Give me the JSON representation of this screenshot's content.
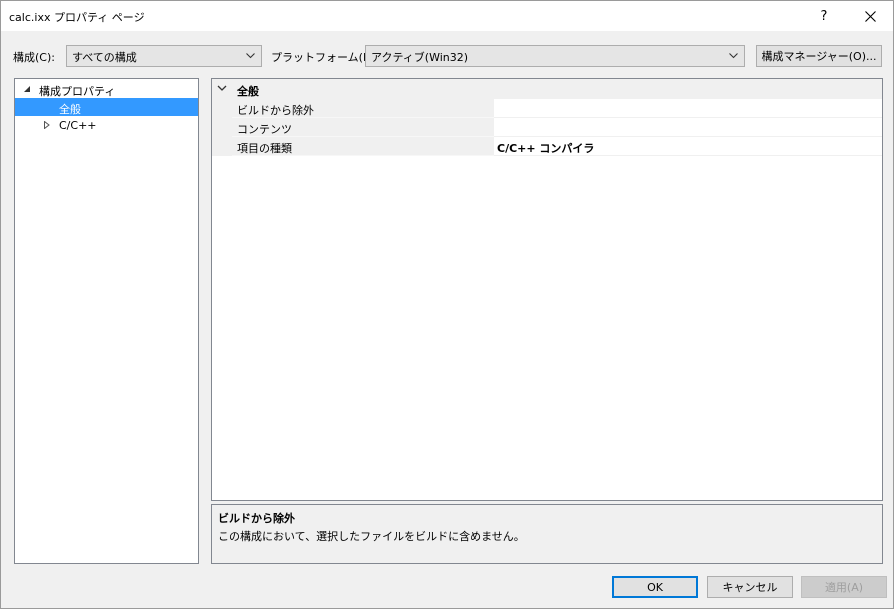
{
  "window": {
    "title": "calc.ixx プロパティ ページ",
    "help_label": "?"
  },
  "toolbar": {
    "config_label": "構成(C):",
    "config_value": "すべての構成",
    "platform_label": "プラットフォーム(P):",
    "platform_value": "アクティブ(Win32)",
    "config_manager_label": "構成マネージャー(O)..."
  },
  "tree": {
    "items": [
      {
        "label": "構成プロパティ",
        "expanded": true
      },
      {
        "label": "全般",
        "selected": true
      },
      {
        "label": "C/C++",
        "expanded": false
      }
    ]
  },
  "grid": {
    "category": "全般",
    "rows": [
      {
        "name": "ビルドから除外",
        "value": ""
      },
      {
        "name": "コンテンツ",
        "value": ""
      },
      {
        "name": "項目の種類",
        "value": "C/C++ コンパイラ"
      }
    ]
  },
  "description": {
    "title": "ビルドから除外",
    "text": "この構成において、選択したファイルをビルドに含めません。"
  },
  "buttons": {
    "ok": "OK",
    "cancel": "キャンセル",
    "apply": "適用(A)"
  },
  "colors": {
    "selection": "#3399ff",
    "default_button_border": "#0078d7"
  }
}
